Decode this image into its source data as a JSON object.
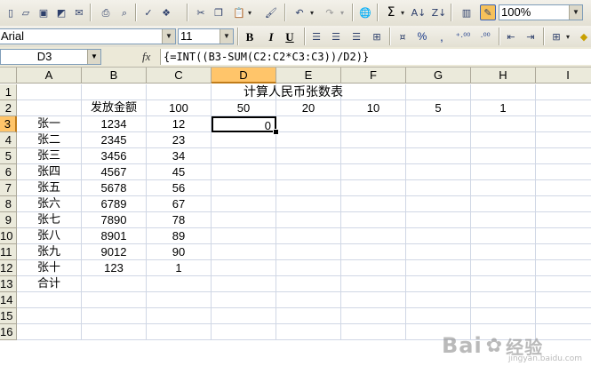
{
  "toolbar": {
    "zoom": "100%",
    "sigma": "Σ",
    "icons": [
      "new-icon",
      "open-icon",
      "save-icon",
      "permission-icon",
      "email-icon",
      "print-icon",
      "print-preview-icon",
      "spelling-icon",
      "research-icon",
      "cut-icon",
      "copy-icon",
      "paste-icon",
      "format-painter-icon",
      "undo-icon",
      "redo-icon",
      "hyperlink-icon",
      "autosum-icon",
      "sort-ascending-icon",
      "sort-descending-icon",
      "chart-wizard-icon",
      "drawing-icon"
    ]
  },
  "format": {
    "font": "Arial",
    "size": "11",
    "bold": "B",
    "italic": "I",
    "underline": "U",
    "percent": "%",
    "comma": ",",
    "inc_decimal": "⁺·⁰⁰",
    "dec_decimal": "·⁰⁰"
  },
  "formula_bar": {
    "name_box": "D3",
    "fx": "fx",
    "formula": "{=INT((B3-SUM(C2:C2*C3:C3))/D2)}"
  },
  "columns": [
    "A",
    "B",
    "C",
    "D",
    "E",
    "F",
    "G",
    "H",
    "I"
  ],
  "selected_column": "D",
  "rows": [
    "1",
    "2",
    "3",
    "4",
    "5",
    "6",
    "7",
    "8",
    "9",
    "10",
    "11",
    "12",
    "13",
    "14",
    "15",
    "16"
  ],
  "selected_row": "3",
  "sheet": {
    "title": "计算人民币张数表",
    "header_row": {
      "b": "发放金额",
      "denominations": [
        "100",
        "50",
        "20",
        "10",
        "5",
        "1"
      ]
    },
    "data": [
      {
        "name": "张一",
        "amount": "1234",
        "c": "12",
        "d": "0"
      },
      {
        "name": "张二",
        "amount": "2345",
        "c": "23"
      },
      {
        "name": "张三",
        "amount": "3456",
        "c": "34"
      },
      {
        "name": "张四",
        "amount": "4567",
        "c": "45"
      },
      {
        "name": "张五",
        "amount": "5678",
        "c": "56"
      },
      {
        "name": "张六",
        "amount": "6789",
        "c": "67"
      },
      {
        "name": "张七",
        "amount": "7890",
        "c": "78"
      },
      {
        "name": "张八",
        "amount": "8901",
        "c": "89"
      },
      {
        "name": "张九",
        "amount": "9012",
        "c": "90"
      },
      {
        "name": "张十",
        "amount": "123",
        "c": "1"
      }
    ],
    "total_label": "合计"
  },
  "watermark": {
    "brand": "Bai",
    "brand2": "经验",
    "url": "jingyan.baidu.com"
  }
}
